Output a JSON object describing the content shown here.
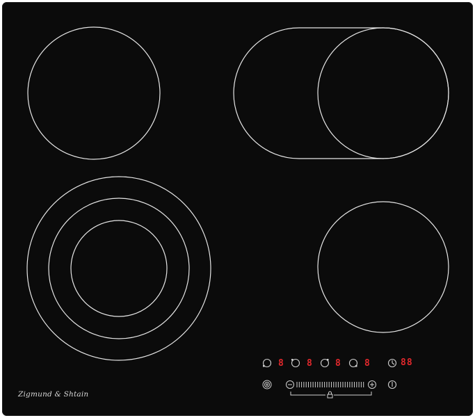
{
  "brand": {
    "name": "Zigmund & Shtain"
  },
  "controls": {
    "zone_displays": [
      "8",
      "8",
      "8",
      "8"
    ],
    "timer_display": "88",
    "slider_minus": "−",
    "slider_plus": "+"
  },
  "colors": {
    "glass": "#0b0b0b",
    "zone_outline": "#e6e6e6",
    "display_red": "#e0282c",
    "icon": "#d0d0d0"
  },
  "icons": [
    "zone-selector-icon",
    "timer-icon",
    "power-icon",
    "lock-icon",
    "minus-icon",
    "plus-icon",
    "dual-zone-icon"
  ]
}
